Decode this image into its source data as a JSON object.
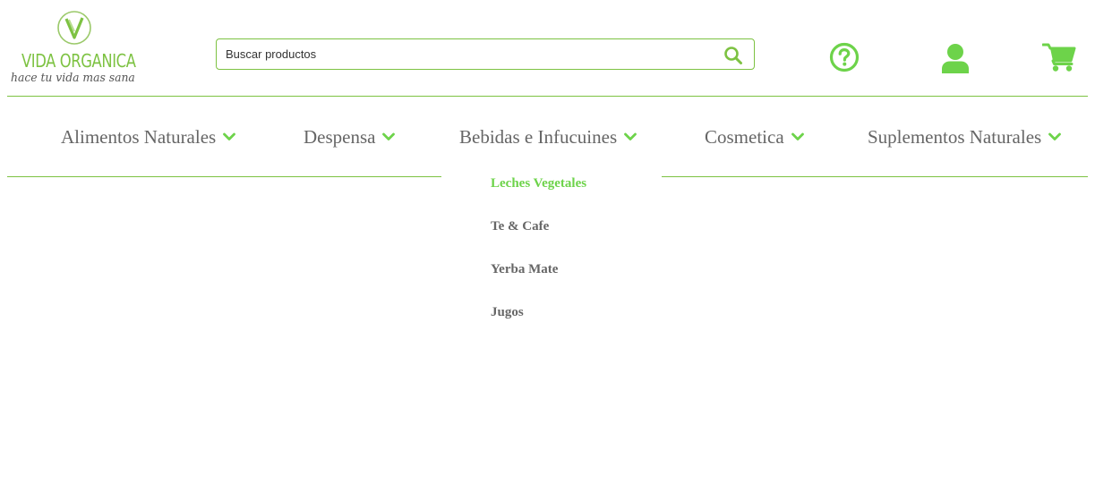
{
  "brand": {
    "name": "VIDA ORGANICA",
    "tagline": "hace tu vida mas sana"
  },
  "search": {
    "placeholder": "Buscar productos",
    "value": ""
  },
  "header_icons": [
    "help-icon",
    "user-icon",
    "cart-icon"
  ],
  "nav": {
    "items": [
      {
        "label": "Alimentos Naturales",
        "icon": "chevron-down-icon"
      },
      {
        "label": "Despensa",
        "icon": "chevron-down-icon"
      },
      {
        "label": "Bebidas e Infucuines",
        "icon": "chevron-down-icon"
      },
      {
        "label": "Cosmetica",
        "icon": "chevron-down-icon"
      },
      {
        "label": "Suplementos Naturales",
        "icon": "chevron-down-icon"
      }
    ]
  },
  "dropdown": {
    "items": [
      {
        "label": "Leches Vegetales",
        "active": true
      },
      {
        "label": "Te & Cafe",
        "active": false
      },
      {
        "label": "Yerba Mate",
        "active": false
      },
      {
        "label": "Jugos",
        "active": false
      }
    ]
  },
  "colors": {
    "accent": "#6dd34a",
    "brand": "#7dc242",
    "text": "#666666"
  }
}
